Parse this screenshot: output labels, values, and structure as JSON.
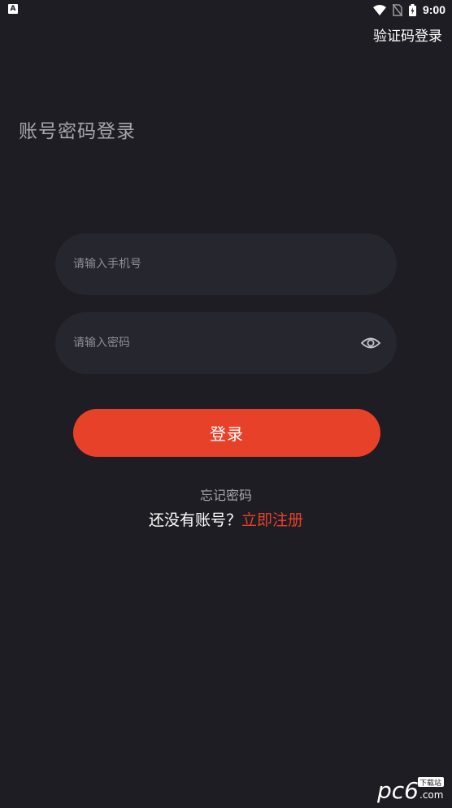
{
  "status_bar": {
    "time": "9:00",
    "left_icon_letter": "A",
    "icons": [
      "wifi-icon",
      "no-sim-icon",
      "battery-icon"
    ]
  },
  "header": {
    "sms_login_label": "验证码登录"
  },
  "title": "账号密码登录",
  "form": {
    "phone_placeholder": "请输入手机号",
    "phone_value": "",
    "password_placeholder": "请输入密码",
    "password_value": "",
    "eye_icon": "eye-icon",
    "login_label": "登录"
  },
  "links": {
    "forgot_password": "忘记密码",
    "register_prompt": "还没有账号？",
    "register_link": "立即注册"
  },
  "watermark": {
    "logo": "pc6",
    "sub_label": "下载站",
    "domain": ".com"
  },
  "colors": {
    "background": "#1e1d23",
    "input_bg": "#25262e",
    "accent": "#e84129",
    "muted_text": "#a6a5aa"
  }
}
